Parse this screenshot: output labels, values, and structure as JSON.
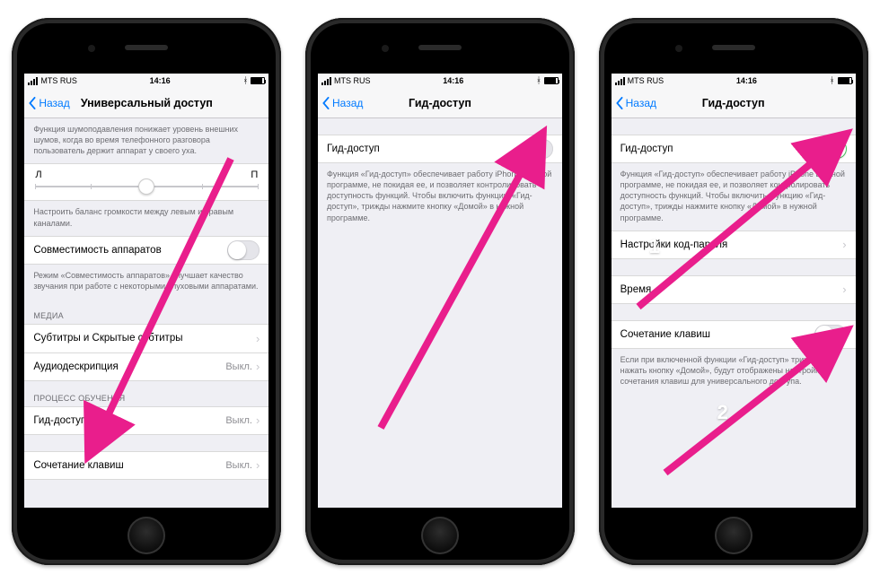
{
  "statusbar": {
    "carrier": "MTS RUS",
    "time": "14:16"
  },
  "phone1": {
    "nav": {
      "back": "Назад",
      "title": "Универсальный доступ"
    },
    "note_noise": "Функция шумоподавления понижает уровень внешних шумов, когда во время телефонного разговора пользователь держит аппарат у своего уха.",
    "balance": {
      "left": "Л",
      "right": "П"
    },
    "note_balance": "Настроить баланс громкости между левым и правым каналами.",
    "row_compat": "Совместимость аппаратов",
    "note_compat": "Режим «Совместимость аппаратов» улучшает качество звучания при работе с некоторыми слуховыми аппаратами.",
    "section_media": "МЕДИА",
    "row_subtitles": "Субтитры и Скрытые субтитры",
    "row_audiodesc": {
      "label": "Аудиодескрипция",
      "value": "Выкл."
    },
    "section_learn": "ПРОЦЕСС ОБУЧЕНИЯ",
    "row_guided": {
      "label": "Гид-доступ",
      "value": "Выкл."
    },
    "row_shortcut": {
      "label": "Сочетание клавиш",
      "value": "Выкл."
    }
  },
  "phone2": {
    "nav": {
      "back": "Назад",
      "title": "Гид-доступ"
    },
    "row_guided": "Гид-доступ",
    "note": "Функция «Гид-доступ» обеспечивает работу iPhone в одной программе, не покидая ее, и позволяет контролировать доступность функций. Чтобы включить функцию «Гид-доступ», трижды нажмите кнопку «Домой» в нужной программе."
  },
  "phone3": {
    "nav": {
      "back": "Назад",
      "title": "Гид-доступ"
    },
    "row_guided": "Гид-доступ",
    "note1": "Функция «Гид-доступ» обеспечивает работу iPhone в одной программе, не покидая ее, и позволяет контролировать доступность функций. Чтобы включить функцию «Гид-доступ», трижды нажмите кнопку «Домой» в нужной программе.",
    "row_passcode": "Настройки код-пароля",
    "row_time": "Время",
    "row_shortcut": "Сочетание клавиш",
    "note2": "Если при включенной функции «Гид-доступ» трижды нажать кнопку «Домой», будут отображены настройки сочетания клавиш для универсального доступа.",
    "badge1": "1",
    "badge2": "2"
  },
  "colors": {
    "accent": "#e91e8c"
  }
}
